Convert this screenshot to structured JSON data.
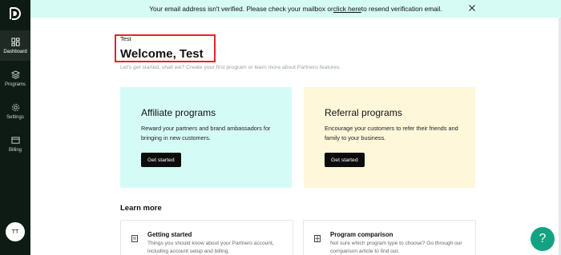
{
  "banner": {
    "text_before": "Your email address isn't verified. Please check your mailbox or ",
    "link": "click here",
    "text_after": " to resend verification email."
  },
  "sidebar": {
    "items": [
      {
        "label": "Dashboard",
        "icon": "dashboard-icon",
        "active": true
      },
      {
        "label": "Programs",
        "icon": "layers-icon",
        "active": false
      },
      {
        "label": "Settings",
        "icon": "gear-icon",
        "active": false
      },
      {
        "label": "Billing",
        "icon": "billing-icon",
        "active": false
      }
    ],
    "avatar": "TT"
  },
  "header": {
    "small_name": "Test",
    "title": "Welcome, Test",
    "subtitle": "Let's get started, shall we? Create your first program or learn more about Partnero features."
  },
  "cards": [
    {
      "title": "Affiliate programs",
      "desc": "Reward your partners and brand ambassadors for bringing in new customers.",
      "button": "Get started"
    },
    {
      "title": "Referral programs",
      "desc": "Encourage your customers to refer their friends and family to your business.",
      "button": "Get started"
    }
  ],
  "learn": {
    "title": "Learn more",
    "items": [
      {
        "title": "Getting started",
        "desc": "Things you should know about your Partnero account, including account setup and billing."
      },
      {
        "title": "Program comparison",
        "desc": "Not sure which program type to choose? Go through our comparison article to find out."
      }
    ]
  },
  "help": "?"
}
